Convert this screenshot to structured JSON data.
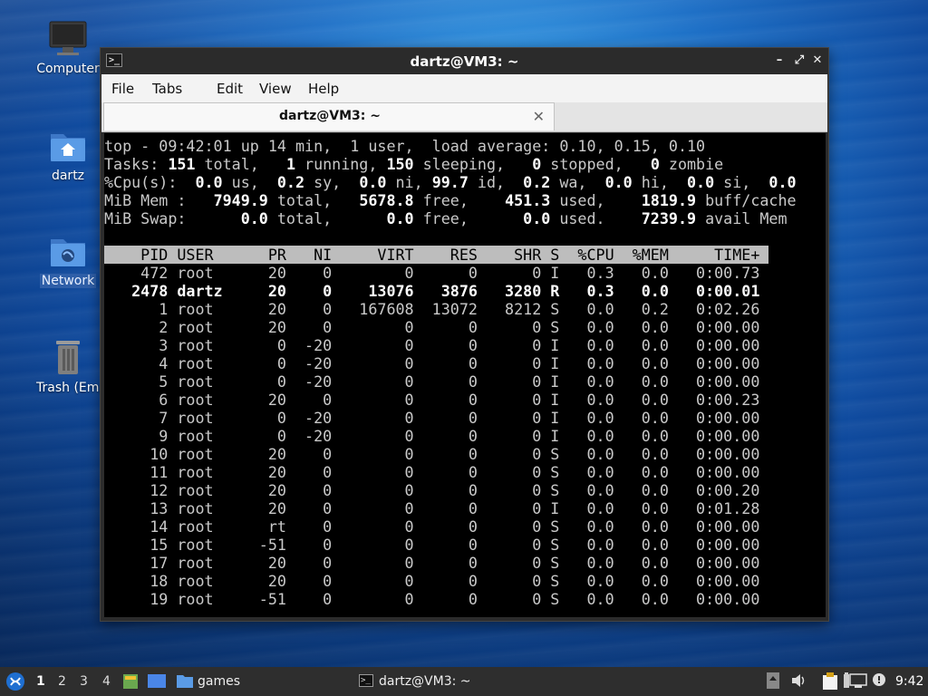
{
  "desktop": {
    "icons": [
      {
        "label": "Computer",
        "icon": "monitor-icon"
      },
      {
        "label": "dartz",
        "icon": "home-folder-icon"
      },
      {
        "label": "Network",
        "icon": "network-folder-icon"
      },
      {
        "label": "Trash (Empt",
        "icon": "trash-icon"
      }
    ]
  },
  "window": {
    "title": "dartz@VM3: ~",
    "menu": [
      "File",
      "Edit",
      "View",
      "Help"
    ],
    "menu_tabs_label": "Tabs",
    "tab_label": "dartz@VM3: ~"
  },
  "top": {
    "summary_line": "top - 09:42:01 up 14 min,  1 user,  load average: 0.10, 0.15, 0.10",
    "tasks": {
      "total": "151",
      "running": "1",
      "sleeping": "150",
      "stopped": "0",
      "zombie": "0"
    },
    "cpu": {
      "us": "0.0",
      "sy": "0.2",
      "ni": "0.0",
      "id": "99.7",
      "wa": "0.2",
      "hi": "0.0",
      "si": "0.0",
      "st": "0.0"
    },
    "mem": {
      "total": "7949.9",
      "free": "5678.8",
      "used": "451.3",
      "buff_cache": "1819.9"
    },
    "swap": {
      "total": "0.0",
      "free": "0.0",
      "used": "0.0",
      "avail": "7239.9"
    },
    "columns": [
      "PID",
      "USER",
      "PR",
      "NI",
      "VIRT",
      "RES",
      "SHR",
      "S",
      "%CPU",
      "%MEM",
      "TIME+"
    ],
    "processes": [
      [
        "472",
        "root",
        "20",
        "0",
        "0",
        "0",
        "0",
        "I",
        "0.3",
        "0.0",
        "0:00.73"
      ],
      [
        "2478",
        "dartz",
        "20",
        "0",
        "13076",
        "3876",
        "3280",
        "R",
        "0.3",
        "0.0",
        "0:00.01"
      ],
      [
        "1",
        "root",
        "20",
        "0",
        "167608",
        "13072",
        "8212",
        "S",
        "0.0",
        "0.2",
        "0:02.26"
      ],
      [
        "2",
        "root",
        "20",
        "0",
        "0",
        "0",
        "0",
        "S",
        "0.0",
        "0.0",
        "0:00.00"
      ],
      [
        "3",
        "root",
        "0",
        "-20",
        "0",
        "0",
        "0",
        "I",
        "0.0",
        "0.0",
        "0:00.00"
      ],
      [
        "4",
        "root",
        "0",
        "-20",
        "0",
        "0",
        "0",
        "I",
        "0.0",
        "0.0",
        "0:00.00"
      ],
      [
        "5",
        "root",
        "0",
        "-20",
        "0",
        "0",
        "0",
        "I",
        "0.0",
        "0.0",
        "0:00.00"
      ],
      [
        "6",
        "root",
        "20",
        "0",
        "0",
        "0",
        "0",
        "I",
        "0.0",
        "0.0",
        "0:00.23"
      ],
      [
        "7",
        "root",
        "0",
        "-20",
        "0",
        "0",
        "0",
        "I",
        "0.0",
        "0.0",
        "0:00.00"
      ],
      [
        "9",
        "root",
        "0",
        "-20",
        "0",
        "0",
        "0",
        "I",
        "0.0",
        "0.0",
        "0:00.00"
      ],
      [
        "10",
        "root",
        "20",
        "0",
        "0",
        "0",
        "0",
        "S",
        "0.0",
        "0.0",
        "0:00.00"
      ],
      [
        "11",
        "root",
        "20",
        "0",
        "0",
        "0",
        "0",
        "S",
        "0.0",
        "0.0",
        "0:00.00"
      ],
      [
        "12",
        "root",
        "20",
        "0",
        "0",
        "0",
        "0",
        "S",
        "0.0",
        "0.0",
        "0:00.20"
      ],
      [
        "13",
        "root",
        "20",
        "0",
        "0",
        "0",
        "0",
        "I",
        "0.0",
        "0.0",
        "0:01.28"
      ],
      [
        "14",
        "root",
        "rt",
        "0",
        "0",
        "0",
        "0",
        "S",
        "0.0",
        "0.0",
        "0:00.00"
      ],
      [
        "15",
        "root",
        "-51",
        "0",
        "0",
        "0",
        "0",
        "S",
        "0.0",
        "0.0",
        "0:00.00"
      ],
      [
        "17",
        "root",
        "20",
        "0",
        "0",
        "0",
        "0",
        "S",
        "0.0",
        "0.0",
        "0:00.00"
      ],
      [
        "18",
        "root",
        "20",
        "0",
        "0",
        "0",
        "0",
        "S",
        "0.0",
        "0.0",
        "0:00.00"
      ],
      [
        "19",
        "root",
        "-51",
        "0",
        "0",
        "0",
        "0",
        "S",
        "0.0",
        "0.0",
        "0:00.00"
      ]
    ],
    "bold_pid": "2478"
  },
  "taskbar": {
    "workspaces": [
      "1",
      "2",
      "3",
      "4"
    ],
    "active_workspace": "1",
    "launcher_folder_label": "games",
    "task_label": "dartz@VM3: ~",
    "clock": "9:42"
  }
}
